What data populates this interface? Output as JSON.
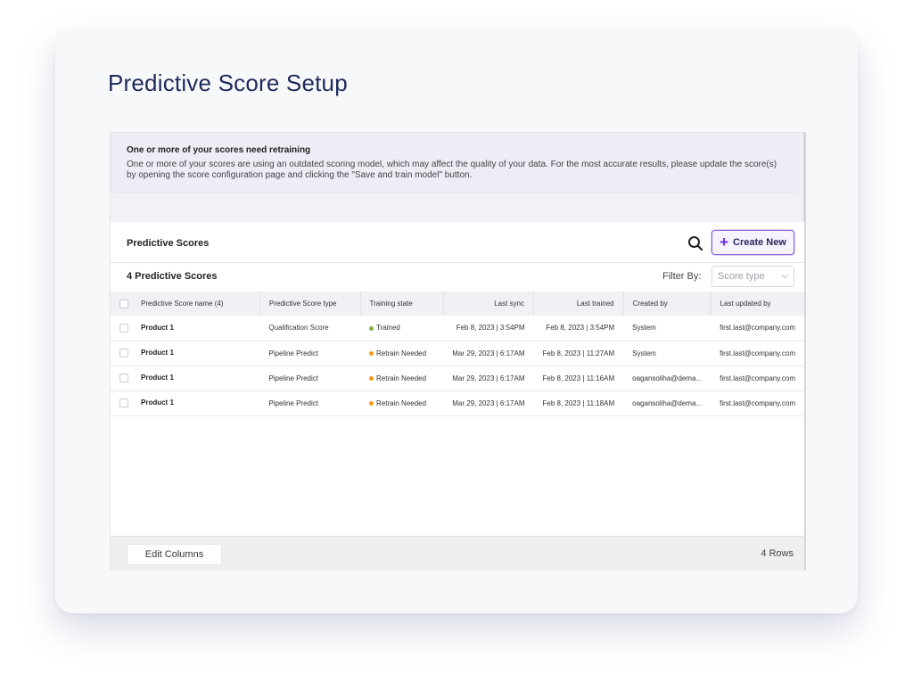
{
  "page": {
    "title": "Predictive Score Setup"
  },
  "alert": {
    "title": "One or more of your scores need retraining",
    "body": "One or more of your scores are using an outdated scoring model, which may affect the quality of your data. For the most accurate results, please update the score(s) by opening the score configuration page and clicking the \"Save and train model\" button."
  },
  "panel": {
    "title": "Predictive Scores",
    "create_label": "Create New",
    "count_title": "4 Predictive Scores",
    "filter_label": "Filter By:",
    "filter_value": "Score type"
  },
  "table": {
    "columns": [
      "Predictive Score name (4)",
      "Predictive Score type",
      "Training state",
      "Last sync",
      "Last trained",
      "Created by",
      "Last updated by"
    ],
    "rows": [
      {
        "name": "Product 1",
        "type": "Qualification Score",
        "state": "Trained",
        "last_sync": "Feb 8, 2023 | 3:54PM",
        "last_trained": "Feb 8, 2023 | 3:54PM",
        "created_by": "System",
        "updated_by": "first.last@company.com"
      },
      {
        "name": "Product 1",
        "type": "Pipeline Predict",
        "state": "Retrain Needed",
        "last_sync": "Mar 29, 2023 | 6:17AM",
        "last_trained": "Feb 8, 2023 | 11:27AM",
        "created_by": "System",
        "updated_by": "first.last@company.com"
      },
      {
        "name": "Product 1",
        "type": "Pipeline Predict",
        "state": "Retrain Needed",
        "last_sync": "Mar 29, 2023 | 6:17AM",
        "last_trained": "Feb 8, 2023 | 11:16AM",
        "created_by": "oagansoliha@dema...",
        "updated_by": "first.last@company.com"
      },
      {
        "name": "Product 1",
        "type": "Pipeline Predict",
        "state": "Retrain Needed",
        "last_sync": "Mar 29, 2023 | 6:17AM",
        "last_trained": "Feb 8, 2023 | 11:18AM",
        "created_by": "oagansoliha@dema...",
        "updated_by": "first.last@company.com"
      }
    ]
  },
  "footer": {
    "edit_columns_label": "Edit Columns",
    "rows_label": "4 Rows"
  },
  "colors": {
    "trained": "#7cb342",
    "retrain": "#f59a1b",
    "accent": "#6a2bd9",
    "title": "#1e2a5a"
  },
  "icons": {
    "search": "search-icon",
    "plus": "plus-icon",
    "chevron": "chevron-down-icon"
  }
}
